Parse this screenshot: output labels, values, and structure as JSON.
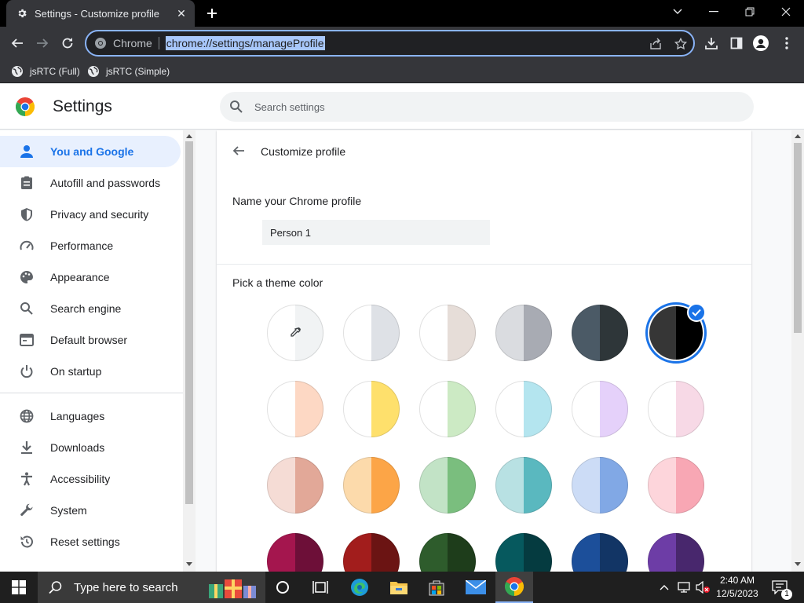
{
  "browser": {
    "tab_title": "Settings - Customize profile",
    "omnibox_scheme": "Chrome",
    "omnibox_url": "chrome://settings/manageProfile",
    "bookmarks": [
      {
        "label": "jsRTC (Full)"
      },
      {
        "label": "jsRTC (Simple)"
      }
    ]
  },
  "settings": {
    "title": "Settings",
    "search_placeholder": "Search settings",
    "nav": [
      {
        "label": "You and Google",
        "icon": "person-icon",
        "active": true
      },
      {
        "label": "Autofill and passwords",
        "icon": "clipboard-icon"
      },
      {
        "label": "Privacy and security",
        "icon": "shield-icon"
      },
      {
        "label": "Performance",
        "icon": "speedometer-icon"
      },
      {
        "label": "Appearance",
        "icon": "palette-icon"
      },
      {
        "label": "Search engine",
        "icon": "search-icon"
      },
      {
        "label": "Default browser",
        "icon": "browser-icon"
      },
      {
        "label": "On startup",
        "icon": "power-icon"
      },
      {
        "label": "Languages",
        "icon": "globe-icon"
      },
      {
        "label": "Downloads",
        "icon": "download-icon"
      },
      {
        "label": "Accessibility",
        "icon": "accessibility-icon"
      },
      {
        "label": "System",
        "icon": "wrench-icon"
      },
      {
        "label": "Reset settings",
        "icon": "reset-icon"
      }
    ],
    "panel": {
      "title": "Customize profile",
      "name_label": "Name your Chrome profile",
      "name_value": "Person 1",
      "theme_label": "Pick a theme color",
      "selected_theme_index": 5,
      "themes": [
        {
          "left": "#ffffff",
          "right": "#f1f3f4",
          "custom": true
        },
        {
          "left": "#ffffff",
          "right": "#dee1e6"
        },
        {
          "left": "#ffffff",
          "right": "#e6ddd8"
        },
        {
          "left": "#dadce0",
          "right": "#a8abb3"
        },
        {
          "left": "#4b5a66",
          "right": "#2e3639"
        },
        {
          "left": "#363636",
          "right": "#000000"
        },
        {
          "left": "#ffffff",
          "right": "#fdd8c4"
        },
        {
          "left": "#ffffff",
          "right": "#fee06c"
        },
        {
          "left": "#ffffff",
          "right": "#cceac4"
        },
        {
          "left": "#ffffff",
          "right": "#b4e5ef"
        },
        {
          "left": "#ffffff",
          "right": "#e5d1fa"
        },
        {
          "left": "#ffffff",
          "right": "#f7d9e6"
        },
        {
          "left": "#f5dcd5",
          "right": "#e2a898"
        },
        {
          "left": "#fcdaab",
          "right": "#fca547"
        },
        {
          "left": "#c2e3c6",
          "right": "#7abe7e"
        },
        {
          "left": "#b8e1e3",
          "right": "#5ab8bf"
        },
        {
          "left": "#ccdcf6",
          "right": "#81a8e5"
        },
        {
          "left": "#fdd5db",
          "right": "#f8a7b4"
        },
        {
          "left": "#a4164e",
          "right": "#6d0f38"
        },
        {
          "left": "#a21d1c",
          "right": "#6b1413"
        },
        {
          "left": "#2e5c2c",
          "right": "#1e3d1b"
        },
        {
          "left": "#06595e",
          "right": "#053b40"
        },
        {
          "left": "#1c4f9a",
          "right": "#123565"
        },
        {
          "left": "#6d3da6",
          "right": "#48276d"
        }
      ]
    }
  },
  "taskbar": {
    "search_placeholder": "Type here to search",
    "time": "2:40 AM",
    "date": "12/5/2023",
    "notification_count": "1"
  },
  "colors": {
    "accent": "#1a73e8",
    "omnibox_focus": "#8ab4f8"
  }
}
